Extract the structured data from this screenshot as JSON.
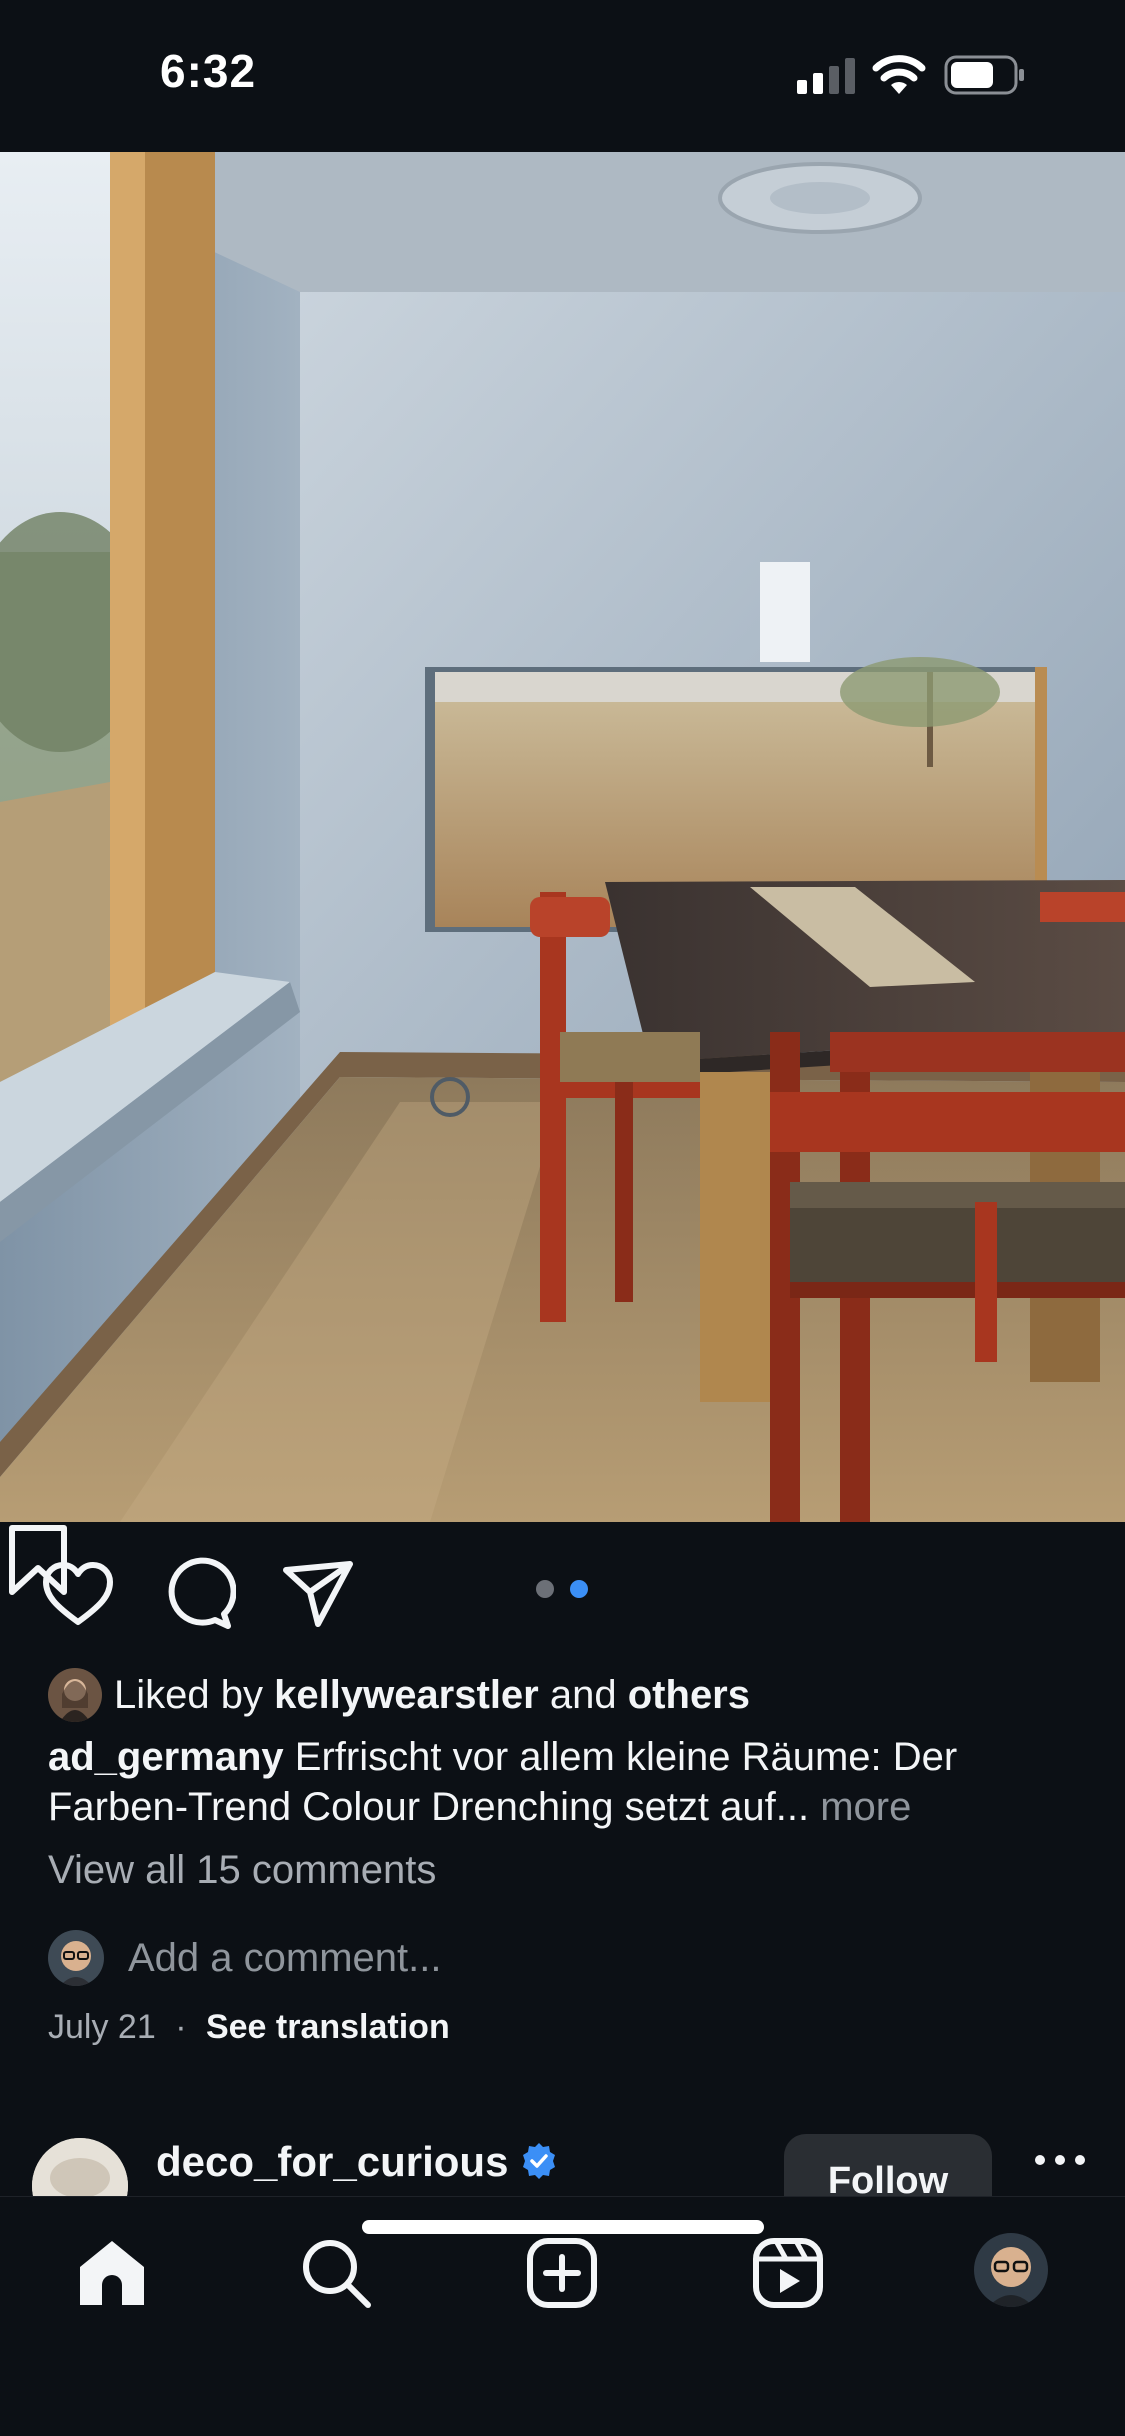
{
  "status_bar": {
    "time": "6:32"
  },
  "post": {
    "carousel": {
      "total": 2,
      "active": 2
    },
    "likes": {
      "prefix": "Liked by",
      "user": "kellywearstler",
      "and": "and",
      "others": "others"
    },
    "caption": {
      "username": "ad_germany",
      "text": "Erfrischt vor allem kleine Räume: Der Farben-Trend Colour Drenching setzt auf...",
      "more": "more"
    },
    "view_comments": "View all 15 comments",
    "add_comment_placeholder": "Add a comment...",
    "date": "July 21",
    "separator": "·",
    "see_translation": "See translation"
  },
  "next_post": {
    "username": "deco_for_curious",
    "follow_label": "Follow"
  },
  "colors": {
    "background": "#0c1015",
    "accent_blue": "#3b8ff6",
    "chair_red": "#a8361f"
  },
  "icons": [
    "heart-icon",
    "comment-icon",
    "send-icon",
    "bookmark-icon",
    "home-icon",
    "search-icon",
    "create-icon",
    "reels-icon",
    "verified-icon",
    "more-icon"
  ]
}
